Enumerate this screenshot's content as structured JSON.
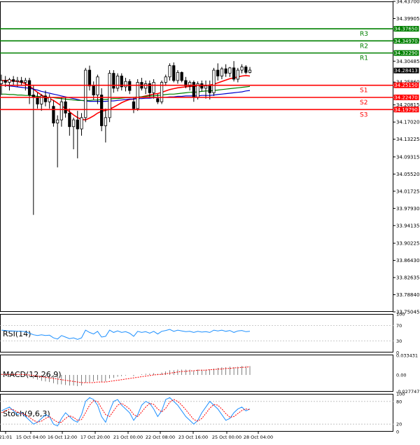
{
  "chart_data": [
    {
      "type": "candlestick",
      "title": "",
      "y_axis": {
        "range": [
          33.7505,
          34.437
        ],
        "tick_labels": [
          "34.43700",
          "34.39905",
          "34.35110",
          "34.30485",
          "34.25860",
          "34.20815",
          "34.17020",
          "34.13225",
          "34.09315",
          "34.05520",
          "34.01725",
          "33.97930",
          "33.94135",
          "33.90225",
          "33.86430",
          "33.82635",
          "33.78840",
          "33.75045"
        ]
      },
      "x_axis": {
        "tick_labels": [
          "21:01",
          "15 Oct 04:00",
          "16 Oct 12:00",
          "17 Oct 20:00",
          "21 Oct 00:00",
          "22 Oct 08:00",
          "23 Oct 16:00",
          "25 Oct 00:00",
          "28 Oct 04:00"
        ]
      },
      "current_price": 34.28413,
      "current_price_label": "34.28413",
      "levels": [
        {
          "name": "R3",
          "value": 34.3765,
          "label": "34.37650",
          "color": "#008000"
        },
        {
          "name": "R2",
          "value": 34.3497,
          "label": "34.34970",
          "color": "#008000"
        },
        {
          "name": "R1",
          "value": 34.3229,
          "label": "34.32290",
          "color": "#008000"
        },
        {
          "name": "S1",
          "value": 34.2515,
          "label": "34.25150",
          "color": "#ff0000"
        },
        {
          "name": "S2",
          "value": 34.2247,
          "label": "34.22470",
          "color": "#ff0000"
        },
        {
          "name": "S3",
          "value": 34.1979,
          "label": "34.19790",
          "color": "#ff0000"
        }
      ],
      "candles": [
        {
          "o": 34.255,
          "h": 34.275,
          "l": 34.23,
          "c": 34.262
        },
        {
          "o": 34.262,
          "h": 34.272,
          "l": 34.248,
          "c": 34.258
        },
        {
          "o": 34.258,
          "h": 34.268,
          "l": 34.24,
          "c": 34.264
        },
        {
          "o": 34.264,
          "h": 34.272,
          "l": 34.252,
          "c": 34.26
        },
        {
          "o": 34.26,
          "h": 34.27,
          "l": 34.248,
          "c": 34.262
        },
        {
          "o": 34.262,
          "h": 34.27,
          "l": 34.25,
          "c": 34.258
        },
        {
          "o": 34.258,
          "h": 34.268,
          "l": 34.24,
          "c": 34.262
        },
        {
          "o": 34.262,
          "h": 34.268,
          "l": 34.21,
          "c": 34.23
        },
        {
          "o": 34.23,
          "h": 34.25,
          "l": 33.965,
          "c": 34.225
        },
        {
          "o": 34.225,
          "h": 34.235,
          "l": 34.2,
          "c": 34.21
        },
        {
          "o": 34.21,
          "h": 34.232,
          "l": 34.195,
          "c": 34.228
        },
        {
          "o": 34.228,
          "h": 34.24,
          "l": 34.205,
          "c": 34.215
        },
        {
          "o": 34.215,
          "h": 34.232,
          "l": 34.2,
          "c": 34.225
        },
        {
          "o": 34.205,
          "h": 34.218,
          "l": 34.16,
          "c": 34.168
        },
        {
          "o": 34.168,
          "h": 34.185,
          "l": 34.07,
          "c": 34.175
        },
        {
          "o": 34.175,
          "h": 34.225,
          "l": 34.16,
          "c": 34.215
        },
        {
          "o": 34.215,
          "h": 34.225,
          "l": 34.18,
          "c": 34.19
        },
        {
          "o": 34.19,
          "h": 34.2,
          "l": 34.14,
          "c": 34.16
        },
        {
          "o": 34.16,
          "h": 34.18,
          "l": 34.11,
          "c": 34.175
        },
        {
          "o": 34.175,
          "h": 34.195,
          "l": 34.09,
          "c": 34.155
        },
        {
          "o": 34.155,
          "h": 34.19,
          "l": 34.14,
          "c": 34.18
        },
        {
          "o": 34.18,
          "h": 34.29,
          "l": 34.17,
          "c": 34.285
        },
        {
          "o": 34.285,
          "h": 34.295,
          "l": 34.24,
          "c": 34.25
        },
        {
          "o": 34.25,
          "h": 34.26,
          "l": 34.22,
          "c": 34.23
        },
        {
          "o": 34.23,
          "h": 34.275,
          "l": 34.21,
          "c": 34.27
        },
        {
          "o": 34.23,
          "h": 34.245,
          "l": 34.15,
          "c": 34.162
        },
        {
          "o": 34.162,
          "h": 34.2,
          "l": 34.125,
          "c": 34.18
        },
        {
          "o": 34.18,
          "h": 34.285,
          "l": 34.17,
          "c": 34.278
        },
        {
          "o": 34.278,
          "h": 34.285,
          "l": 34.235,
          "c": 34.245
        },
        {
          "o": 34.245,
          "h": 34.278,
          "l": 34.238,
          "c": 34.272
        },
        {
          "o": 34.272,
          "h": 34.278,
          "l": 34.24,
          "c": 34.248
        },
        {
          "o": 34.248,
          "h": 34.268,
          "l": 34.238,
          "c": 34.26
        },
        {
          "o": 34.26,
          "h": 34.265,
          "l": 34.232,
          "c": 34.24
        },
        {
          "o": 34.215,
          "h": 34.225,
          "l": 34.19,
          "c": 34.2
        },
        {
          "o": 34.2,
          "h": 34.265,
          "l": 34.195,
          "c": 34.258
        },
        {
          "o": 34.258,
          "h": 34.268,
          "l": 34.24,
          "c": 34.245
        },
        {
          "o": 34.245,
          "h": 34.262,
          "l": 34.232,
          "c": 34.255
        },
        {
          "o": 34.255,
          "h": 34.262,
          "l": 34.225,
          "c": 34.235
        },
        {
          "o": 34.235,
          "h": 34.265,
          "l": 34.222,
          "c": 34.258
        },
        {
          "o": 34.222,
          "h": 34.232,
          "l": 34.21,
          "c": 34.215
        },
        {
          "o": 34.215,
          "h": 34.262,
          "l": 34.21,
          "c": 34.258
        },
        {
          "o": 34.258,
          "h": 34.275,
          "l": 34.25,
          "c": 34.27
        },
        {
          "o": 34.27,
          "h": 34.3,
          "l": 34.262,
          "c": 34.295
        },
        {
          "o": 34.295,
          "h": 34.302,
          "l": 34.258,
          "c": 34.262
        },
        {
          "o": 34.262,
          "h": 34.285,
          "l": 34.255,
          "c": 34.28
        },
        {
          "o": 34.28,
          "h": 34.282,
          "l": 34.258,
          "c": 34.262
        },
        {
          "o": 34.262,
          "h": 34.27,
          "l": 34.245,
          "c": 34.25
        },
        {
          "o": 34.25,
          "h": 34.262,
          "l": 34.24,
          "c": 34.258
        },
        {
          "o": 34.258,
          "h": 34.262,
          "l": 34.215,
          "c": 34.225
        },
        {
          "o": 34.225,
          "h": 34.26,
          "l": 34.22,
          "c": 34.255
        },
        {
          "o": 34.255,
          "h": 34.262,
          "l": 34.238,
          "c": 34.245
        },
        {
          "o": 34.245,
          "h": 34.262,
          "l": 34.222,
          "c": 34.25
        },
        {
          "o": 34.25,
          "h": 34.262,
          "l": 34.22,
          "c": 34.235
        },
        {
          "o": 34.235,
          "h": 34.29,
          "l": 34.228,
          "c": 34.285
        },
        {
          "o": 34.285,
          "h": 34.3,
          "l": 34.262,
          "c": 34.272
        },
        {
          "o": 34.272,
          "h": 34.292,
          "l": 34.265,
          "c": 34.288
        },
        {
          "o": 34.288,
          "h": 34.298,
          "l": 34.27,
          "c": 34.278
        },
        {
          "o": 34.278,
          "h": 34.292,
          "l": 34.27,
          "c": 34.29
        },
        {
          "o": 34.29,
          "h": 34.305,
          "l": 34.26,
          "c": 34.265
        },
        {
          "o": 34.265,
          "h": 34.29,
          "l": 34.258,
          "c": 34.285
        },
        {
          "o": 34.285,
          "h": 34.298,
          "l": 34.278,
          "c": 34.292
        },
        {
          "o": 34.292,
          "h": 34.296,
          "l": 34.276,
          "c": 34.28
        },
        {
          "o": 34.28,
          "h": 34.292,
          "l": 34.278,
          "c": 34.285
        }
      ],
      "moving_averages": [
        {
          "color": "#ff0000",
          "values": [
            34.262,
            34.262,
            34.262,
            34.261,
            34.26,
            34.258,
            34.255,
            34.25,
            34.243,
            34.236,
            34.23,
            34.225,
            34.222,
            34.218,
            34.212,
            34.206,
            34.2,
            34.193,
            34.186,
            34.18,
            34.176,
            34.175,
            34.179,
            34.184,
            34.19,
            34.194,
            34.196,
            34.199,
            34.203,
            34.208,
            34.213,
            34.217,
            34.22,
            34.221,
            34.224,
            34.226,
            34.228,
            34.23,
            34.232,
            34.233,
            34.236,
            34.239,
            34.242,
            34.244,
            34.246,
            34.247,
            34.248,
            34.249,
            34.249,
            34.25,
            34.25,
            34.251,
            34.252,
            34.254,
            34.257,
            34.26,
            34.263,
            34.266,
            34.268,
            34.27,
            34.272,
            34.273,
            34.272
          ]
        },
        {
          "color": "#0000cc",
          "values": [
            34.252,
            34.251,
            34.25,
            34.249,
            34.248,
            34.247,
            34.246,
            34.245,
            34.243,
            34.241,
            34.238,
            34.236,
            34.234,
            34.232,
            34.23,
            34.228,
            34.226,
            34.224,
            34.222,
            34.22,
            34.218,
            34.217,
            34.216,
            34.216,
            34.216,
            34.216,
            34.216,
            34.217,
            34.217,
            34.218,
            34.219,
            34.22,
            34.221,
            34.221,
            34.222,
            34.222,
            34.223,
            34.223,
            34.224,
            34.224,
            34.225,
            34.225,
            34.226,
            34.226,
            34.227,
            34.227,
            34.228,
            34.228,
            34.228,
            34.228,
            34.229,
            34.229,
            34.229,
            34.23,
            34.231,
            34.232,
            34.233,
            34.234,
            34.235,
            34.236,
            34.237,
            34.239,
            34.24
          ]
        },
        {
          "color": "#008000",
          "values": [
            34.232,
            34.232,
            34.231,
            34.231,
            34.23,
            34.23,
            34.229,
            34.229,
            34.228,
            34.227,
            34.226,
            34.225,
            34.225,
            34.224,
            34.223,
            34.222,
            34.221,
            34.22,
            34.219,
            34.218,
            34.218,
            34.218,
            34.218,
            34.219,
            34.219,
            34.22,
            34.22,
            34.221,
            34.222,
            34.222,
            34.223,
            34.224,
            34.224,
            34.225,
            34.226,
            34.226,
            34.227,
            34.228,
            34.228,
            34.229,
            34.23,
            34.231,
            34.232,
            34.232,
            34.233,
            34.234,
            34.235,
            34.236,
            34.236,
            34.237,
            34.238,
            34.239,
            34.239,
            34.24,
            34.241,
            34.242,
            34.243,
            34.244,
            34.245,
            34.246,
            34.247,
            34.248,
            34.249
          ]
        }
      ]
    },
    {
      "type": "line",
      "title": "RSI(14)",
      "y_axis": {
        "range": [
          0,
          100
        ],
        "tick_labels": [
          "100",
          "70",
          "30",
          "0"
        ]
      },
      "levels": [
        70,
        30
      ],
      "series": [
        {
          "color": "#1e90ff",
          "values": [
            58,
            57,
            56,
            56,
            55,
            55,
            54,
            50,
            46,
            44,
            46,
            44,
            45,
            38,
            35,
            44,
            40,
            36,
            38,
            34,
            38,
            58,
            52,
            48,
            55,
            40,
            42,
            58,
            52,
            56,
            52,
            54,
            50,
            42,
            55,
            52,
            54,
            50,
            55,
            48,
            55,
            57,
            60,
            55,
            58,
            56,
            54,
            55,
            52,
            55,
            53,
            54,
            52,
            58,
            56,
            58,
            55,
            57,
            52,
            56,
            57,
            54,
            55
          ]
        }
      ]
    },
    {
      "type": "bar",
      "title": "MACD(12,26,9)",
      "y_axis": {
        "range": [
          -0.0285,
          0.0345
        ],
        "tick_labels": [
          "0.033431",
          "0.00",
          "-0.027747"
        ]
      },
      "series": [
        {
          "type": "histogram",
          "color": "#000000",
          "values": [
            0.002,
            0.002,
            0.001,
            0.001,
            0.0005,
            0.0,
            -0.001,
            -0.003,
            -0.006,
            -0.008,
            -0.01,
            -0.011,
            -0.012,
            -0.014,
            -0.016,
            -0.016,
            -0.017,
            -0.018,
            -0.018,
            -0.019,
            -0.018,
            -0.013,
            -0.012,
            -0.011,
            -0.009,
            -0.012,
            -0.011,
            -0.006,
            -0.005,
            -0.003,
            -0.002,
            -0.001,
            0.0,
            -0.002,
            0.0,
            0.001,
            0.002,
            0.002,
            0.003,
            0.002,
            0.004,
            0.006,
            0.008,
            0.008,
            0.009,
            0.009,
            0.009,
            0.009,
            0.008,
            0.009,
            0.009,
            0.009,
            0.009,
            0.011,
            0.012,
            0.013,
            0.013,
            0.014,
            0.013,
            0.014,
            0.015,
            0.015,
            0.015
          ]
        },
        {
          "type": "signal",
          "color": "#ff0000",
          "values": [
            0.001,
            0.001,
            0.001,
            0.001,
            0.001,
            0.001,
            0.0005,
            0.0,
            -0.001,
            -0.002,
            -0.003,
            -0.004,
            -0.005,
            -0.006,
            -0.007,
            -0.008,
            -0.009,
            -0.01,
            -0.011,
            -0.012,
            -0.013,
            -0.013,
            -0.013,
            -0.013,
            -0.012,
            -0.012,
            -0.012,
            -0.011,
            -0.01,
            -0.009,
            -0.008,
            -0.007,
            -0.006,
            -0.005,
            -0.004,
            -0.003,
            -0.002,
            -0.001,
            0.0,
            0.0005,
            0.001,
            0.002,
            0.003,
            0.004,
            0.005,
            0.006,
            0.006,
            0.007,
            0.007,
            0.008,
            0.008,
            0.008,
            0.009,
            0.009,
            0.01,
            0.01,
            0.011,
            0.011,
            0.012,
            0.012,
            0.013,
            0.013,
            0.014
          ]
        }
      ]
    },
    {
      "type": "line",
      "title": "Stoch(9,6,3)",
      "y_axis": {
        "range": [
          0,
          100
        ],
        "tick_labels": [
          "100",
          "80",
          "20",
          "0"
        ]
      },
      "levels": [
        80,
        20
      ],
      "series": [
        {
          "color": "#1e90ff",
          "values": [
            55,
            60,
            65,
            55,
            45,
            50,
            40,
            30,
            20,
            25,
            35,
            45,
            40,
            20,
            15,
            35,
            50,
            40,
            30,
            25,
            45,
            80,
            90,
            85,
            70,
            40,
            25,
            55,
            80,
            85,
            70,
            60,
            50,
            30,
            45,
            70,
            80,
            75,
            60,
            40,
            55,
            85,
            90,
            80,
            70,
            55,
            40,
            30,
            20,
            30,
            50,
            65,
            80,
            70,
            60,
            45,
            30,
            35,
            50,
            60,
            65,
            55,
            60
          ]
        },
        {
          "color": "#ff0000",
          "values": [
            50,
            55,
            60,
            58,
            52,
            48,
            45,
            38,
            30,
            25,
            28,
            35,
            40,
            32,
            25,
            25,
            35,
            42,
            38,
            30,
            32,
            50,
            70,
            82,
            80,
            62,
            45,
            40,
            55,
            70,
            75,
            68,
            60,
            45,
            40,
            52,
            65,
            75,
            72,
            60,
            52,
            62,
            78,
            85,
            80,
            70,
            58,
            45,
            32,
            28,
            35,
            48,
            62,
            72,
            70,
            60,
            48,
            38,
            40,
            48,
            56,
            60,
            58
          ]
        }
      ]
    }
  ]
}
